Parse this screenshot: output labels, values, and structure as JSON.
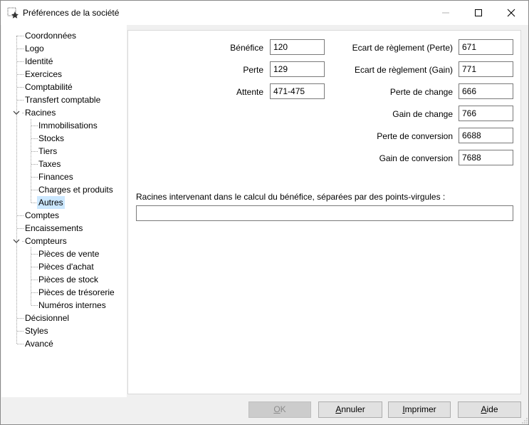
{
  "window": {
    "title": "Préférences de la société"
  },
  "tree": {
    "items": [
      {
        "label": "Coordonnées"
      },
      {
        "label": "Logo"
      },
      {
        "label": "Identité"
      },
      {
        "label": "Exercices"
      },
      {
        "label": "Comptabilité"
      },
      {
        "label": "Transfert comptable"
      },
      {
        "label": "Racines",
        "expanded": true,
        "children": [
          {
            "label": "Immobilisations"
          },
          {
            "label": "Stocks"
          },
          {
            "label": "Tiers"
          },
          {
            "label": "Taxes"
          },
          {
            "label": "Finances"
          },
          {
            "label": "Charges et produits"
          },
          {
            "label": "Autres",
            "selected": true
          }
        ]
      },
      {
        "label": "Comptes"
      },
      {
        "label": "Encaissements"
      },
      {
        "label": "Compteurs",
        "expanded": true,
        "children": [
          {
            "label": "Pièces de vente"
          },
          {
            "label": "Pièces d'achat"
          },
          {
            "label": "Pièces de stock"
          },
          {
            "label": "Pièces de trésorerie"
          },
          {
            "label": "Numéros internes"
          }
        ]
      },
      {
        "label": "Décisionnel"
      },
      {
        "label": "Styles"
      },
      {
        "label": "Avancé"
      }
    ]
  },
  "form": {
    "left": [
      {
        "label": "Bénéfice",
        "value": "120"
      },
      {
        "label": "Perte",
        "value": "129"
      },
      {
        "label": "Attente",
        "value": "471-475"
      }
    ],
    "right": [
      {
        "label": "Ecart de règlement (Perte)",
        "value": "671"
      },
      {
        "label": "Ecart de règlement (Gain)",
        "value": "771"
      },
      {
        "label": "Perte de change",
        "value": "666"
      },
      {
        "label": "Gain de change",
        "value": "766"
      },
      {
        "label": "Perte de conversion",
        "value": "6688"
      },
      {
        "label": "Gain de conversion",
        "value": "7688"
      }
    ],
    "roots_label": "Racines intervenant dans le calcul du bénéfice, séparées par des points-virgules :",
    "roots_value": ""
  },
  "buttons": {
    "ok": {
      "first": "O",
      "rest": "K"
    },
    "cancel": {
      "first": "A",
      "rest": "nnuler"
    },
    "print": {
      "first": "I",
      "rest": "mprimer"
    },
    "help": {
      "first": "A",
      "rest": "ide"
    }
  }
}
